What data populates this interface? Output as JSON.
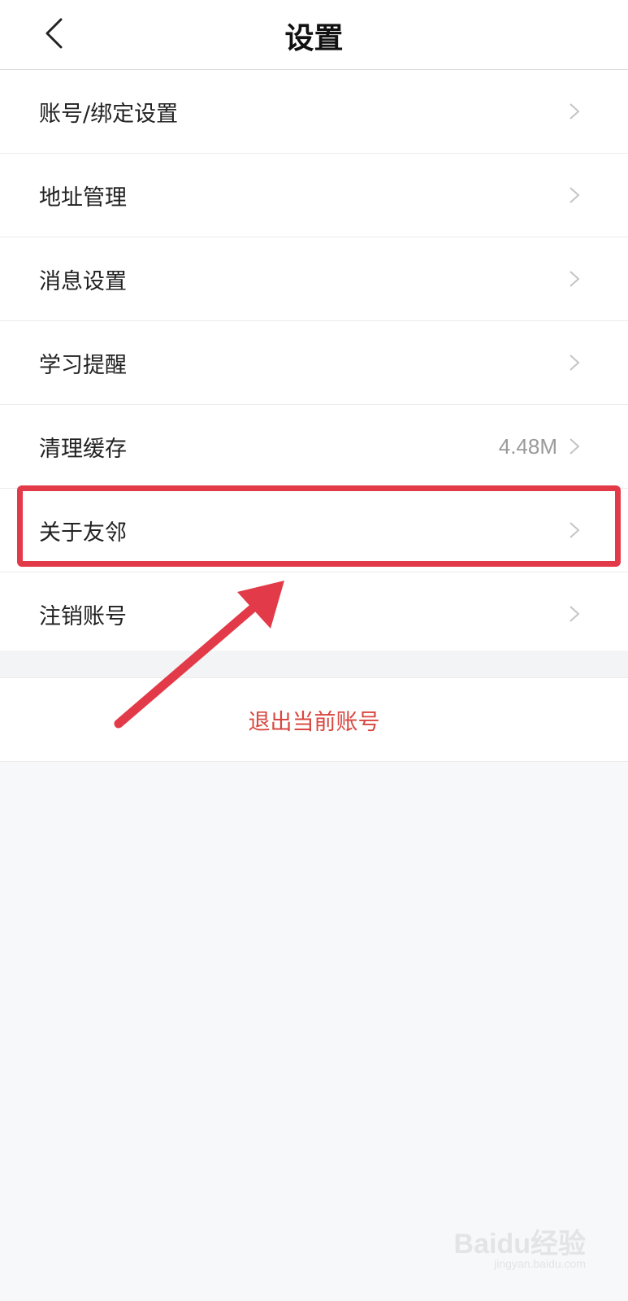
{
  "header": {
    "title": "设置",
    "back_icon": "chevron-left-icon"
  },
  "settings": {
    "items": [
      {
        "label": "账号/绑定设置",
        "value": ""
      },
      {
        "label": "地址管理",
        "value": ""
      },
      {
        "label": "消息设置",
        "value": ""
      },
      {
        "label": "学习提醒",
        "value": ""
      },
      {
        "label": "清理缓存",
        "value": "4.48M"
      },
      {
        "label": "关于友邻",
        "value": ""
      },
      {
        "label": "注销账号",
        "value": ""
      }
    ]
  },
  "logout": {
    "label": "退出当前账号",
    "color": "#d9463f"
  },
  "annotation": {
    "highlight_color": "#e23a48",
    "highlighted_item": "关于友邻"
  },
  "watermark": {
    "text": "Baidu经验",
    "sub": "jingyan.baidu.com"
  }
}
